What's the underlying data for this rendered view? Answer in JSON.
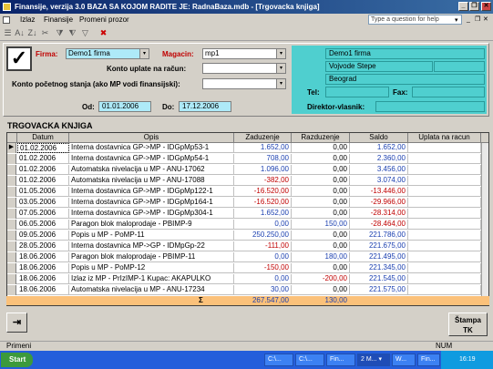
{
  "window": {
    "title": "Finansije, verzija 3.0     BAZA SA KOJOM RADITE JE: RadnaBaza.mdb - [Trgovacka knjiga]",
    "minimize": "_",
    "restore": "❐",
    "close": "✕"
  },
  "menu": {
    "items": [
      "Izlaz",
      "Finansije",
      "Promeni prozor"
    ],
    "help_placeholder": "Type a question for help",
    "help_arrow": "▾",
    "mini_min": "_",
    "mini_restore": "❐",
    "mini_close": "✕"
  },
  "toolbar": {
    "icons": [
      "☰",
      "A↓",
      "Z↓",
      "✂",
      "⧩",
      "⧨",
      "▽",
      "✖"
    ]
  },
  "form": {
    "check_glyph": "✓",
    "firma_label": "Firma:",
    "firma_value": "Demo1 firma",
    "magacin_label": "Magacin:",
    "magacin_value": "mp1",
    "konto_uplate_label": "Konto uplate na račun:",
    "konto_uplate_value": "",
    "konto_pocetnog_label": "Konto početnog stanja (ako MP vodi finansijski):",
    "konto_pocetnog_value": "",
    "od_label": "Od:",
    "od_value": "01.01.2006",
    "do_label": "Do:",
    "do_value": "17.12.2006",
    "dropdown_glyph": "▾"
  },
  "info": {
    "company": "Demo1 firma",
    "address": "Vojvode Stepe",
    "city": "Beograd",
    "tel_label": "Tel:",
    "fax_label": "Fax:",
    "director_label": "Direktor-vlasnik:"
  },
  "section_title": "TRGOVACKA KNJIGA",
  "table": {
    "headers": [
      "Datum",
      "Opis",
      "Zaduzenje",
      "Razduzenje",
      "Saldo",
      "Uplata na racun"
    ],
    "rows": [
      {
        "marker": "▶",
        "date": "01.02.2006",
        "desc": "Interna dostavnica GP->MP - IDGpMp53-1",
        "zad": "1.652,00",
        "raz": "0,00",
        "saldo": "1.652,00",
        "upl": ""
      },
      {
        "marker": "",
        "date": "01.02.2006",
        "desc": "Interna dostavnica GP->MP - IDGpMp54-1",
        "zad": "708,00",
        "raz": "0,00",
        "saldo": "2.360,00",
        "upl": ""
      },
      {
        "marker": "",
        "date": "01.02.2006",
        "desc": "Automatska nivelacija u MP - ANU-17062",
        "zad": "1.096,00",
        "raz": "0,00",
        "saldo": "3.456,00",
        "upl": ""
      },
      {
        "marker": "",
        "date": "01.02.2006",
        "desc": "Automatska nivelacija u MP - ANU-17088",
        "zad": "-382,00",
        "raz": "0,00",
        "saldo": "3.074,00",
        "upl": ""
      },
      {
        "marker": "",
        "date": "01.05.2006",
        "desc": "Interna dostavnica GP->MP - IDGpMp122-1",
        "zad": "-16.520,00",
        "raz": "0,00",
        "saldo": "-13.446,00",
        "upl": ""
      },
      {
        "marker": "",
        "date": "03.05.2006",
        "desc": "Interna dostavnica GP->MP - IDGpMp164-1",
        "zad": "-16.520,00",
        "raz": "0,00",
        "saldo": "-29.966,00",
        "upl": ""
      },
      {
        "marker": "",
        "date": "07.05.2006",
        "desc": "Interna dostavnica GP->MP - IDGpMp304-1",
        "zad": "1.652,00",
        "raz": "0,00",
        "saldo": "-28.314,00",
        "upl": ""
      },
      {
        "marker": "",
        "date": "06.05.2006",
        "desc": "Paragon blok maloprodaje - PBIMP-9",
        "zad": "0,00",
        "raz": "150,00",
        "saldo": "-28.464,00",
        "upl": ""
      },
      {
        "marker": "",
        "date": "09.05.2006",
        "desc": "Popis u MP - PoMP-11",
        "zad": "250.250,00",
        "raz": "0,00",
        "saldo": "221.786,00",
        "upl": ""
      },
      {
        "marker": "",
        "date": "28.05.2006",
        "desc": "Interna dostavnica MP->GP - IDMpGp-22",
        "zad": "-111,00",
        "raz": "0,00",
        "saldo": "221.675,00",
        "upl": ""
      },
      {
        "marker": "",
        "date": "18.06.2006",
        "desc": "Paragon blok maloprodaje - PBIMP-11",
        "zad": "0,00",
        "raz": "180,00",
        "saldo": "221.495,00",
        "upl": ""
      },
      {
        "marker": "",
        "date": "18.06.2006",
        "desc": "Popis u MP - PoMP-12",
        "zad": "-150,00",
        "raz": "0,00",
        "saldo": "221.345,00",
        "upl": ""
      },
      {
        "marker": "",
        "date": "18.06.2006",
        "desc": "Izlaz iz MP - PrIzIMP-1 Kupac: AKAPULKO",
        "zad": "0,00",
        "raz": "-200,00",
        "saldo": "221.545,00",
        "upl": ""
      },
      {
        "marker": "",
        "date": "18.06.2006",
        "desc": "Automatska nivelacija u MP - ANU-17234",
        "zad": "30,00",
        "raz": "0,00",
        "saldo": "221.575,00",
        "upl": ""
      }
    ],
    "total_symbol": "Σ",
    "total_zad": "267.547,00",
    "total_raz": "130,00"
  },
  "buttons": {
    "exit_glyph": "⇥",
    "print_label_1": "Štampa",
    "print_label_2": "TK"
  },
  "status": {
    "left": "Primeni",
    "right": "NUM"
  },
  "taskbar": {
    "start": "Start",
    "items": [
      "C:\\...",
      "C:\\...",
      "Fin...",
      "2 M... ▾",
      "W...",
      "Fin..."
    ],
    "clock": "16:19"
  },
  "colors": {
    "accent": "#0a246a",
    "info_panel": "#4fcfcf",
    "date_field": "#aeeaf8",
    "total_row": "#fbc17a",
    "negative": "#c00000",
    "positive": "#1a3fb0"
  }
}
